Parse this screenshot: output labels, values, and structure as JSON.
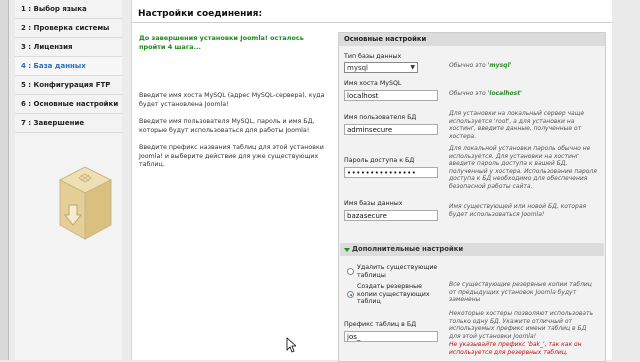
{
  "sidebar": {
    "steps": [
      {
        "label": "1 : Выбор языка"
      },
      {
        "label": "2 : Проверка системы"
      },
      {
        "label": "3 : Лицензия"
      },
      {
        "label": "4 : База данных"
      },
      {
        "label": "5 : Конфигурация FTP"
      },
      {
        "label": "6 : Основные настройки"
      },
      {
        "label": "7 : Завершение"
      }
    ],
    "active_index": 3,
    "active_color": "#2a6ebd"
  },
  "main": {
    "title": "Настройки соединения:",
    "green_note_line1": "До завершения установки Joomla! осталось",
    "green_note_line2": "пройти 4 шага...",
    "help_host_line1": "Введите имя хоста MySQL (адрес MySQL-сервера), куда",
    "help_host_line2": "будет установлена Joomla!",
    "help_user_line1": "Введите имя пользователя MySQL, пароль и имя БД,",
    "help_user_line2": "которые будут использоваться для работы Joomla!",
    "help_prefix_line1": "Введите префикс названия таблиц для этой установки",
    "help_prefix_line2": "Joomla! и выберите действие для уже существующих",
    "help_prefix_line3": "таблиц."
  },
  "panel": {
    "title": "Основные настройки",
    "db_type_label": "Тип базы данных",
    "db_type_value": "mysql",
    "db_type_note_prefix": "Обычно это",
    "db_type_note_value": "'mysql'",
    "host_label": "Имя хоста MySQL",
    "host_value": "localhost",
    "host_note_prefix": "Обычно это",
    "host_note_value": "'localhost'",
    "user_label": "Имя пользователя БД",
    "user_value": "adminsecure",
    "user_note_line1": "Для установки на локальный сервер чаще",
    "user_note_line2": "используется 'root', а для установки на",
    "user_note_line3": "хостинг, введите данные, полученные от",
    "user_note_line4": "хостера.",
    "password_label": "Пароль доступа к БД",
    "password_value": "•••••••••••••••",
    "password_note_line1": "Для локальной установки пароль обычно не",
    "password_note_line2": "используется. Для установки на хостинг",
    "password_note_line3": "введите пароль доступа к вашей БД,",
    "password_note_line4": "полученный у хостера. Использование пароля",
    "password_note_line5": "доступа к БД необходимо для обеспечения",
    "password_note_line6": "безопасной работы сайта.",
    "dbname_label": "Имя базы данных",
    "dbname_value": "bazasecure",
    "dbname_note_line1": "Имя существующей или новой БД, которая",
    "dbname_note_line2": "будет использоваться Joomla!",
    "advanced_title": "Дополнительные настройки",
    "radio1_line1": "Удалить существующие",
    "radio1_line2": "таблицы",
    "radio1_note": "",
    "radio2_line1": "Создать резервные",
    "radio2_line2": "копии существующих",
    "radio2_line3": "таблиц",
    "radio2_note_line1": "Все существующие резервные копии таблиц",
    "radio2_note_line2": "от предыдущих установок Joomla будут",
    "radio2_note_line3": "заменены",
    "prefix_label": "Префикс таблиц в БД",
    "prefix_value": "jos_",
    "prefix_note_line1": "Некоторые хостеры позволяют использовать",
    "prefix_note_line2": "только одну БД. Укажите отличный от",
    "prefix_note_line3": "используемых префикс имени таблиц в БД",
    "prefix_note_line4": "для этой установки Joomla!",
    "prefix_warn_line1": "Не указывайте префикс 'bak_', так как он",
    "prefix_warn_line2": "используется для резервных таблиц."
  }
}
